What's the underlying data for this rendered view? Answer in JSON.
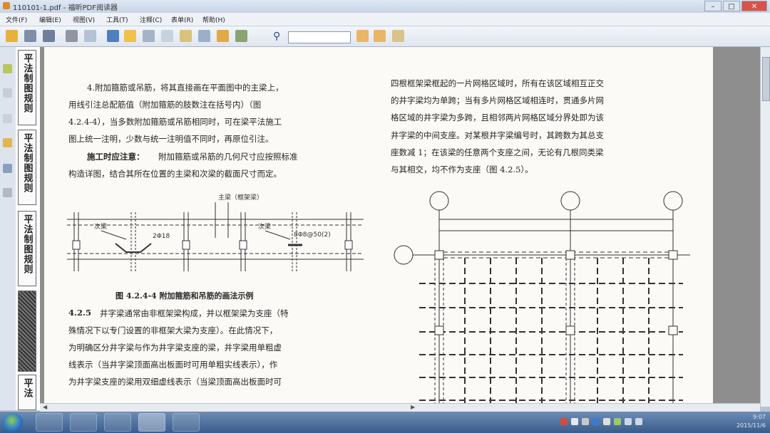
{
  "window": {
    "title": "110101-1.pdf - 福昕PDF阅读器"
  },
  "menu": [
    "文件(F)",
    "编辑(E)",
    "视图(V)",
    "工具(T)",
    "注释(C)",
    "表单(R)",
    "帮助(H)"
  ],
  "bookmarks": [
    "平法制图规则",
    "平法制图规则",
    "平法制图规则",
    "平法"
  ],
  "left_column": {
    "p1": [
      "4.附加箍筋或吊筋，将其直接画在平面图中的主梁上，",
      "用线引注总配筋值（附加箍筋的肢数注在括号内）（图",
      "4.2.4-4），当多数附加箍筋或吊筋相同时，可在梁平法施工",
      "图上统一注明，少数与统一注明值不同时，再原位引注。"
    ],
    "note_label": "施工时应注意：",
    "note_rest": "附加箍筋或吊筋的几何尺寸应按照标准",
    "note_line2": "构造详图，结合其所在位置的主梁和次梁的截面尺寸而定。",
    "fig_caption": "图 4.2.4-4  附加箍筋和吊筋的画法示例",
    "fig_labels": {
      "main_beam": "主梁（框架梁）",
      "sub_beam_1": "次梁",
      "sub_beam_2": "次梁",
      "rebar_1": "2Φ18",
      "rebar_2": "8Φ8@50(2)"
    },
    "section_num": "4.2.5",
    "p2_first": "井字梁通常由非框架梁构成，并以框架梁为支座（特",
    "p2": [
      "殊情况下以专门设置的非框架大梁为支座）。在此情况下，",
      "为明确区分井字梁与作为井字梁支座的梁，井字梁用单粗虚",
      "线表示（当井字梁顶面高出板面时可用单粗实线表示），作",
      "为井字梁支座的梁用双细虚线表示（当梁顶面高出板面时可"
    ]
  },
  "right_column": {
    "p": [
      "四根框架梁框起的一片网格区域时，所有在该区域相互正交",
      "的井字梁均为单跨；当有多片网格区域相连时，贯通多片网",
      "格区域的井字梁为多跨，且相邻两片网格区域分界处即为该",
      "井字梁的中间支座。对某根井字梁编号时，其跨数为其总支",
      "座数减 1；在该梁的任意两个支座之间，无论有几根同类梁",
      "与其相交，均不作为支座（图 4.2.5）。"
    ]
  },
  "taskbar": {
    "time": "9:07",
    "date": "2015/11/6"
  }
}
